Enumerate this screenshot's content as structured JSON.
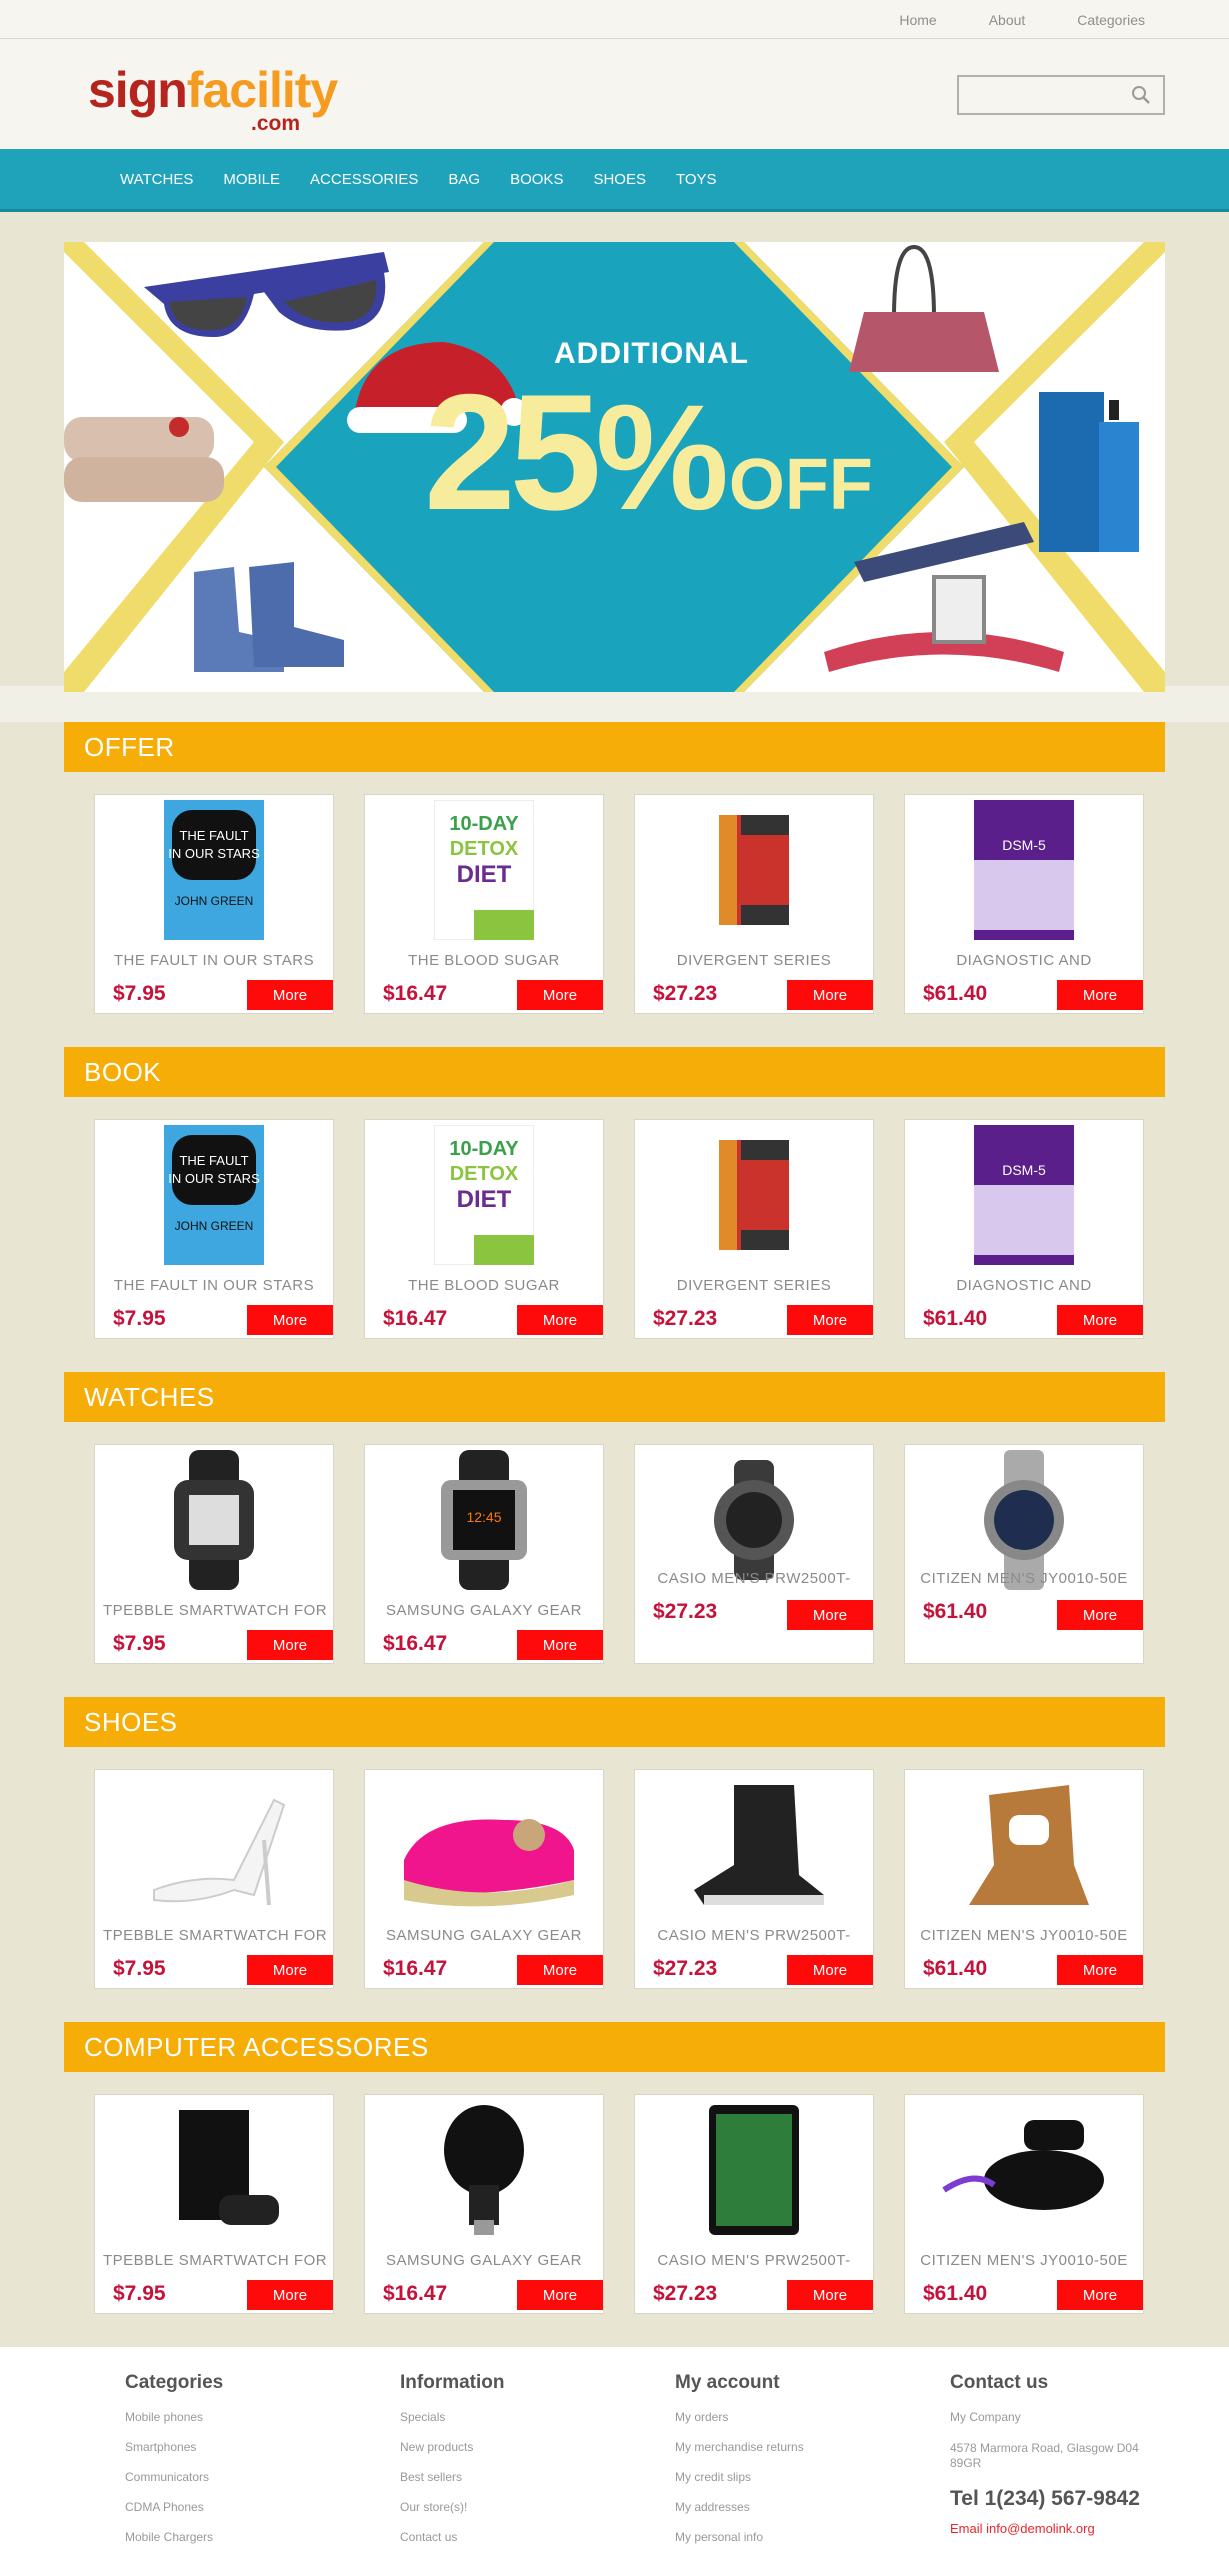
{
  "toplinks": [
    "Home",
    "About",
    "Categories"
  ],
  "logo": {
    "part1": "sign",
    "part2": "facility",
    "domain": ".com"
  },
  "search": {
    "placeholder": ""
  },
  "nav": [
    "WATCHES",
    "MOBILE",
    "ACCESSORIES",
    "BAG",
    "BOOKS",
    "SHOES",
    "TOYS"
  ],
  "hero": {
    "top": "ADDITIONAL",
    "big": "25",
    "pct": "%",
    "off": "OFF"
  },
  "sections": [
    {
      "title": "OFFER",
      "products": [
        {
          "name": "THE FAULT IN OUR STARS",
          "price": "$7.95",
          "more": "More",
          "icon": "book-fault-in-our-stars"
        },
        {
          "name": "THE BLOOD SUGAR",
          "price": "$16.47",
          "more": "More",
          "icon": "book-blood-sugar"
        },
        {
          "name": "DIVERGENT SERIES",
          "price": "$27.23",
          "more": "More",
          "icon": "book-divergent"
        },
        {
          "name": "DIAGNOSTIC AND",
          "price": "$61.40",
          "more": "More",
          "icon": "book-dsm5"
        }
      ]
    },
    {
      "title": "BOOK",
      "products": [
        {
          "name": "THE FAULT IN OUR STARS",
          "price": "$7.95",
          "more": "More",
          "icon": "book-fault-in-our-stars"
        },
        {
          "name": "THE BLOOD SUGAR",
          "price": "$16.47",
          "more": "More",
          "icon": "book-blood-sugar"
        },
        {
          "name": "DIVERGENT SERIES",
          "price": "$27.23",
          "more": "More",
          "icon": "book-divergent"
        },
        {
          "name": "DIAGNOSTIC AND",
          "price": "$61.40",
          "more": "More",
          "icon": "book-dsm5"
        }
      ]
    },
    {
      "title": "WATCHES",
      "products": [
        {
          "name": "TPEBBLE SMARTWATCH FOR",
          "price": "$7.95",
          "more": "More",
          "icon": "pebble-watch"
        },
        {
          "name": "SAMSUNG GALAXY GEAR",
          "price": "$16.47",
          "more": "More",
          "icon": "galaxy-gear-watch"
        },
        {
          "name": "CASIO MEN'S PRW2500T-",
          "price": "$27.23",
          "more": "More",
          "icon": "casio-watch"
        },
        {
          "name": "CITIZEN MEN'S JY0010-50E",
          "price": "$61.40",
          "more": "More",
          "icon": "citizen-watch"
        }
      ]
    },
    {
      "title": "SHOES",
      "products": [
        {
          "name": "TPEBBLE SMARTWATCH FOR",
          "price": "$7.95",
          "more": "More",
          "icon": "white-heel-shoe"
        },
        {
          "name": "SAMSUNG GALAXY GEAR",
          "price": "$16.47",
          "more": "More",
          "icon": "pink-kid-shoe"
        },
        {
          "name": "CASIO MEN'S PRW2500T-",
          "price": "$27.23",
          "more": "More",
          "icon": "black-wedge-boot"
        },
        {
          "name": "CITIZEN MEN'S JY0010-50E",
          "price": "$61.40",
          "more": "More",
          "icon": "tan-bootie"
        }
      ]
    },
    {
      "title": "COMPUTER ACCESSORES",
      "products": [
        {
          "name": "TPEBBLE SMARTWATCH FOR",
          "price": "$7.95",
          "more": "More",
          "icon": "game-console"
        },
        {
          "name": "SAMSUNG GALAXY GEAR",
          "price": "$16.47",
          "more": "More",
          "icon": "chromecast"
        },
        {
          "name": "CASIO MEN'S PRW2500T-",
          "price": "$27.23",
          "more": "More",
          "icon": "tablet"
        },
        {
          "name": "CITIZEN MEN'S JY0010-50E",
          "price": "$61.40",
          "more": "More",
          "icon": "streaming-box"
        }
      ]
    }
  ],
  "footer": {
    "categories": {
      "title": "Categories",
      "links": [
        "Mobile phones",
        "Smartphones",
        "Communicators",
        "CDMA Phones",
        "Mobile Chargers"
      ]
    },
    "information": {
      "title": "Information",
      "links": [
        "Specials",
        "New products",
        "Best sellers",
        "Our store(s)!",
        "Contact us"
      ]
    },
    "account": {
      "title": "My account",
      "links": [
        "My orders",
        "My merchandise returns",
        "My credit slips",
        "My addresses",
        "My personal info"
      ]
    },
    "contact": {
      "title": "Contact us",
      "company": "My Company",
      "address": "4578 Marmora Road, Glasgow D04 89GR",
      "tel": "Tel 1(234) 567-9842",
      "email": "Email info@demolink.org"
    }
  },
  "colors": {
    "accent": "#1fa3bb",
    "section": "#f6ad07",
    "button": "#ff0a0a",
    "price": "#c4123a",
    "background": "#e8e6d2"
  }
}
